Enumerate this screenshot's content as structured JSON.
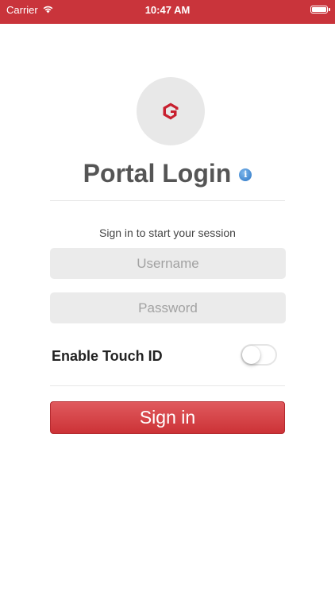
{
  "status_bar": {
    "carrier": "Carrier",
    "time": "10:47 AM",
    "background_color": "#c9343b",
    "battery_level": 1.0
  },
  "logo": {
    "icon": "g-logo-icon",
    "accent_color": "#c8202f"
  },
  "header": {
    "title": "Portal Login",
    "info_icon_glyph": "i"
  },
  "form": {
    "subtitle": "Sign in to start your session",
    "username": {
      "value": "",
      "placeholder": "Username"
    },
    "password": {
      "value": "",
      "placeholder": "Password"
    },
    "touch_id": {
      "label": "Enable Touch ID",
      "enabled": false
    },
    "submit_label": "Sign in"
  },
  "colors": {
    "brand": "#c9343b",
    "button": "#d9464b",
    "info": "#2a74c4"
  }
}
